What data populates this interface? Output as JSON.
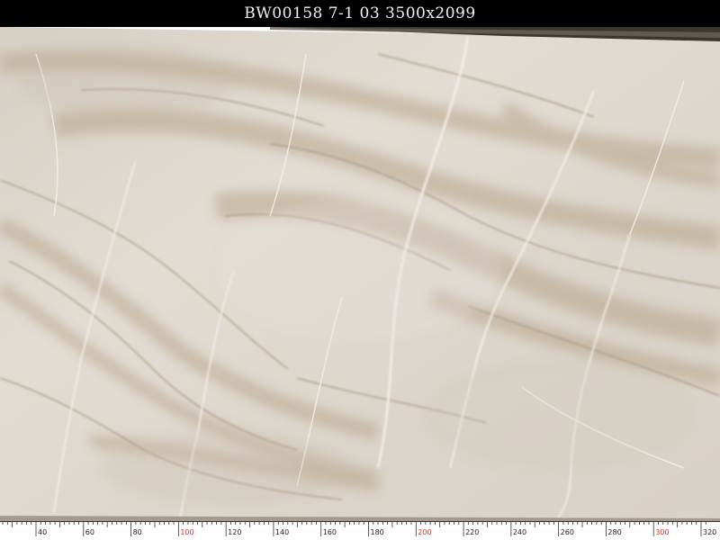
{
  "header": {
    "title": "BW00158 7-1 03 3500x2099"
  },
  "slab": {
    "material": "quartzite slab",
    "colors": {
      "base": "#ddd6cb",
      "vein_tan": "#b9a58d",
      "vein_light": "#efebe4",
      "header_bg": "#000000"
    }
  },
  "ruler": {
    "labels": [
      {
        "value": 40,
        "text": "40",
        "highlight": false
      },
      {
        "value": 60,
        "text": "60",
        "highlight": false
      },
      {
        "value": 80,
        "text": "80",
        "highlight": false
      },
      {
        "value": 100,
        "text": "100",
        "highlight": true
      },
      {
        "value": 120,
        "text": "120",
        "highlight": false
      },
      {
        "value": 140,
        "text": "140",
        "highlight": false
      },
      {
        "value": 160,
        "text": "160",
        "highlight": false
      },
      {
        "value": 180,
        "text": "180",
        "highlight": false
      },
      {
        "value": 200,
        "text": "200",
        "highlight": true
      },
      {
        "value": 220,
        "text": "220",
        "highlight": false
      },
      {
        "value": 240,
        "text": "240",
        "highlight": false
      },
      {
        "value": 260,
        "text": "260",
        "highlight": false
      },
      {
        "value": 280,
        "text": "280",
        "highlight": false
      },
      {
        "value": 300,
        "text": "300",
        "highlight": true
      },
      {
        "value": 320,
        "text": "320",
        "highlight": false
      }
    ],
    "label_color": "#222222",
    "highlight_color": "#e0302a"
  }
}
